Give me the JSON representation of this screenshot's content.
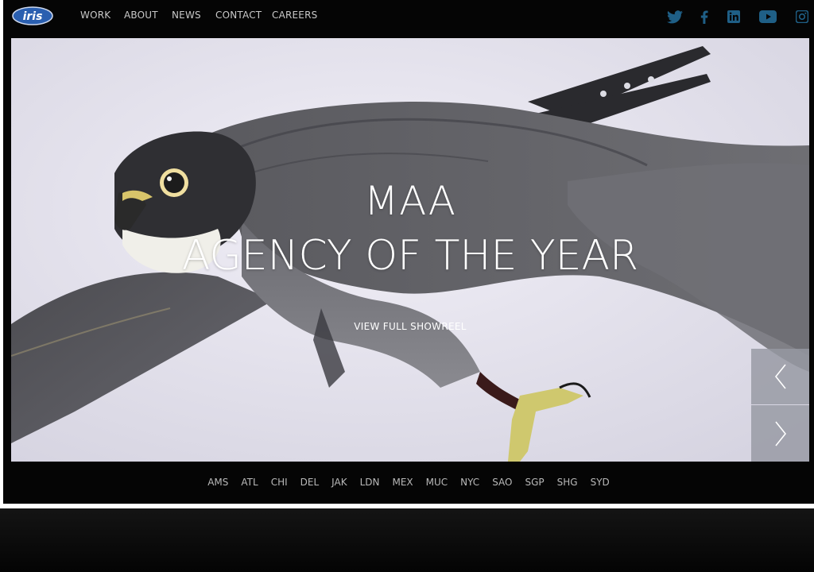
{
  "brand": {
    "logo_text": "iris"
  },
  "nav": {
    "items": [
      {
        "label": "WORK"
      },
      {
        "label": "ABOUT"
      },
      {
        "label": "NEWS"
      },
      {
        "label": "CONTACT"
      },
      {
        "label": "CAREERS"
      }
    ]
  },
  "social": [
    {
      "icon": "twitter-icon"
    },
    {
      "icon": "facebook-icon"
    },
    {
      "icon": "linkedin-icon"
    },
    {
      "icon": "youtube-icon"
    },
    {
      "icon": "instagram-icon"
    }
  ],
  "hero": {
    "headline_line1": "MAA",
    "headline_line2": "AGENCY OF THE YEAR",
    "cta": "VIEW FULL SHOWREEL"
  },
  "carousel": {
    "prev_icon": "chevron-left-icon",
    "next_icon": "chevron-right-icon"
  },
  "offices": [
    "AMS",
    "ATL",
    "CHI",
    "DEL",
    "JAK",
    "LDN",
    "MEX",
    "MUC",
    "NYC",
    "SAO",
    "SGP",
    "SHG",
    "SYD"
  ],
  "colors": {
    "background": "#050505",
    "nav_text": "#c8c8c8",
    "social_icon": "#1f5f86",
    "logo_blue": "#2a5fb0",
    "city_text": "#b9b9b9"
  }
}
